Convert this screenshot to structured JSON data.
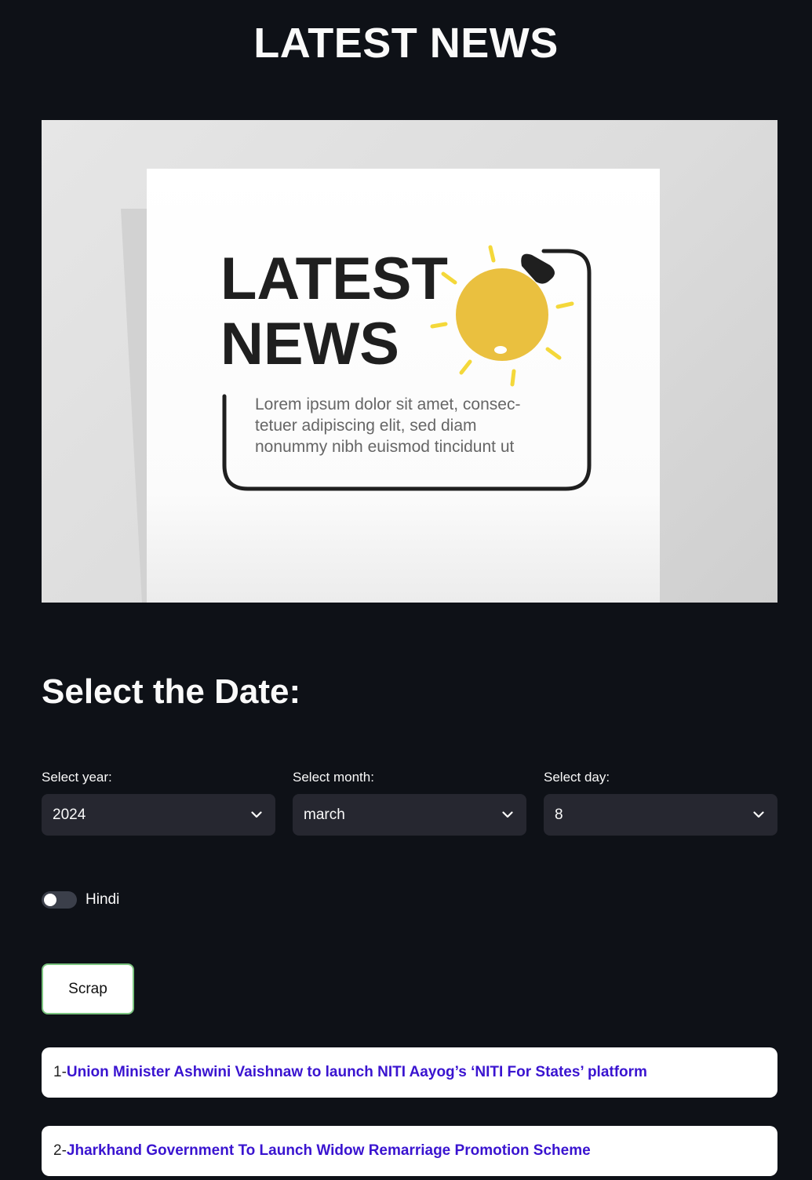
{
  "header": {
    "title": "LATEST NEWS"
  },
  "banner": {
    "headline_line1": "LATEST",
    "headline_line2": "NEWS",
    "body_line1": "Lorem ipsum dolor sit amet, consec-",
    "body_line2": "tetuer adipiscing elit, sed diam",
    "body_line3": "nonummy nibh euismod tincidunt ut",
    "bulb_color": "#eac03f",
    "ray_color": "#f4d83a"
  },
  "date_section": {
    "heading": "Select the Date:",
    "year": {
      "label": "Select year:",
      "value": "2024"
    },
    "month": {
      "label": "Select month:",
      "value": "march"
    },
    "day": {
      "label": "Select day:",
      "value": "8"
    }
  },
  "language_toggle": {
    "label": "Hindi",
    "on": false
  },
  "actions": {
    "scrap_label": "Scrap"
  },
  "news": [
    {
      "index": "1- ",
      "title": "Union Minister Ashwini Vaishnaw to launch NITI Aayog’s ‘NITI For States’ platform"
    },
    {
      "index": "2- ",
      "title": "Jharkhand Government To Launch Widow Remarriage Promotion Scheme"
    }
  ],
  "colors": {
    "background": "#0e1117",
    "select_bg": "#262730",
    "link": "#3a14d0",
    "button_border": "#7bc47f"
  }
}
